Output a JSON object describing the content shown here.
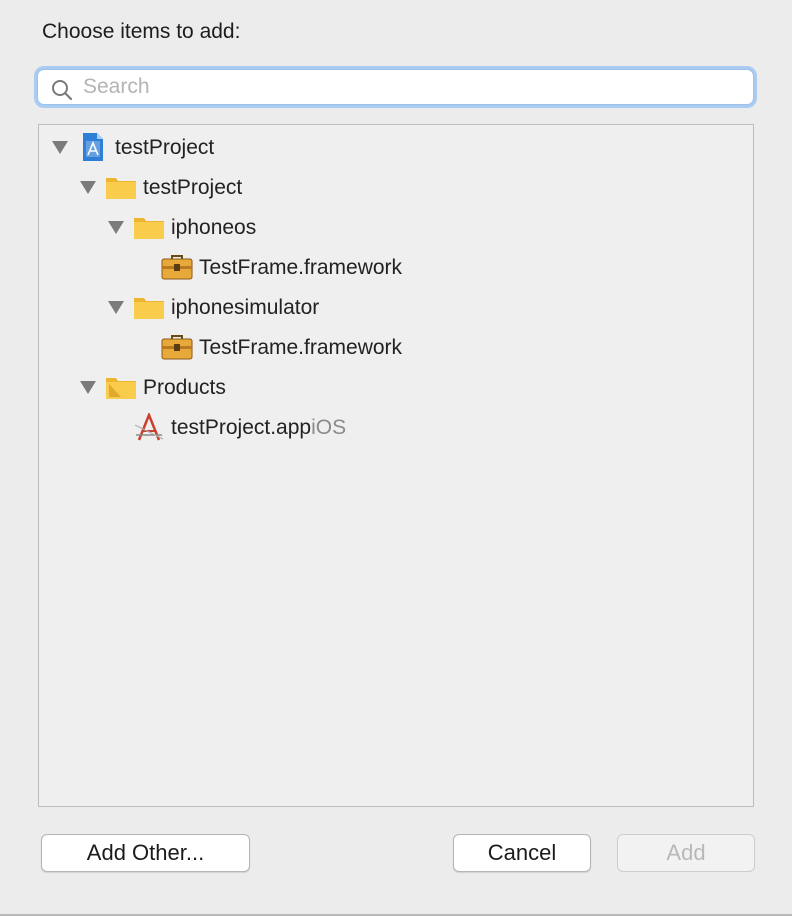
{
  "dialog": {
    "title": "Choose items to add:",
    "search": {
      "placeholder": "Search",
      "value": ""
    },
    "tree": [
      {
        "label": "testProject",
        "subtitle": "",
        "icon": "xcode-project-icon",
        "expanded": true
      },
      {
        "label": "testProject",
        "subtitle": "",
        "icon": "folder-icon",
        "expanded": true
      },
      {
        "label": "iphoneos",
        "subtitle": "",
        "icon": "folder-icon",
        "expanded": true
      },
      {
        "label": "TestFrame.framework",
        "subtitle": "",
        "icon": "framework-toolbox-icon",
        "expanded": null
      },
      {
        "label": "iphonesimulator",
        "subtitle": "",
        "icon": "folder-icon",
        "expanded": true
      },
      {
        "label": "TestFrame.framework",
        "subtitle": "",
        "icon": "framework-toolbox-icon",
        "expanded": null
      },
      {
        "label": "Products",
        "subtitle": "",
        "icon": "products-folder-icon",
        "expanded": true
      },
      {
        "label": "testProject.app",
        "subtitle": "iOS",
        "icon": "app-product-icon",
        "expanded": null
      }
    ],
    "buttons": {
      "add_other": "Add Other...",
      "cancel": "Cancel",
      "add": "Add"
    },
    "colors": {
      "folder": "#f7c746",
      "search_focus": "#a9ccf0",
      "toolbox": "#e7a93a"
    }
  }
}
